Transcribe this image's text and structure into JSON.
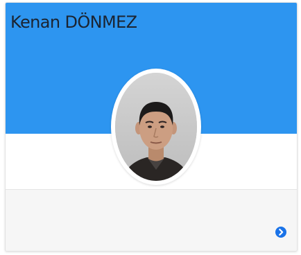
{
  "profile": {
    "name": "Kenan DÖNMEZ"
  },
  "icons": {
    "avatar": "person-photo",
    "footer_action": "arrow-circle-right-icon"
  },
  "colors": {
    "header_bg": "#2d95f0",
    "title_text": "#1b2431",
    "footer_bg": "#f6f6f6",
    "action_icon": "#1a73e8"
  }
}
